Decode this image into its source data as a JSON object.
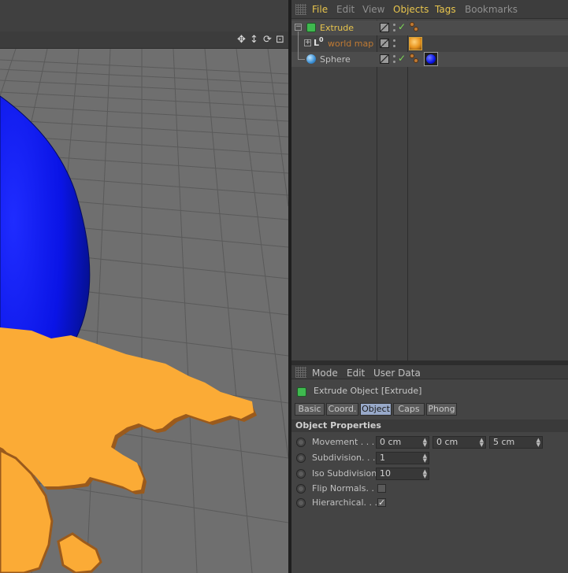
{
  "object_manager": {
    "menu": [
      {
        "label": "File",
        "highlight": true
      },
      {
        "label": "Edit",
        "highlight": false
      },
      {
        "label": "View",
        "highlight": false
      },
      {
        "label": "Objects",
        "highlight": true
      },
      {
        "label": "Tags",
        "highlight": true
      },
      {
        "label": "Bookmarks",
        "highlight": false
      }
    ],
    "objects": [
      {
        "name": "Extrude",
        "color": "#e8c54d",
        "icon": "extrude-icon",
        "enabled_check": true,
        "tag": "phong-tag"
      },
      {
        "name": "world map",
        "color": "#c07a33",
        "icon": "spline-icon",
        "enabled_check": false,
        "tag": "material-tag-orange",
        "prefix": "0"
      },
      {
        "name": "Sphere",
        "color": "#c0c0c0",
        "icon": "sphere-icon",
        "enabled_check": true,
        "tag": "material-tag-blue"
      }
    ]
  },
  "attribute_manager": {
    "menu": [
      "Mode",
      "Edit",
      "User Data"
    ],
    "title": "Extrude Object [Extrude]",
    "tabs": [
      {
        "label": "Basic",
        "active": false
      },
      {
        "label": "Coord.",
        "active": false
      },
      {
        "label": "Object",
        "active": true
      },
      {
        "label": "Caps",
        "active": false
      },
      {
        "label": "Phong",
        "active": false
      }
    ],
    "section_title": "Object Properties",
    "properties": {
      "movement": {
        "label": "Movement . . .",
        "values": [
          "0 cm",
          "0 cm",
          "5 cm"
        ]
      },
      "subdivision": {
        "label": "Subdivision. . .",
        "value": "1"
      },
      "iso_subdivision": {
        "label": "Iso Subdivision",
        "value": "10"
      },
      "flip_normals": {
        "label": "Flip Normals. .",
        "checked": false
      },
      "hierarchical": {
        "label": "Hierarchical. . .",
        "checked": true
      }
    }
  },
  "colors": {
    "accent_yellow": "#e8c54d",
    "tab_active": "#98a9c9",
    "sphere_blue": "#0a14e6",
    "map_orange": "#fbab36"
  }
}
